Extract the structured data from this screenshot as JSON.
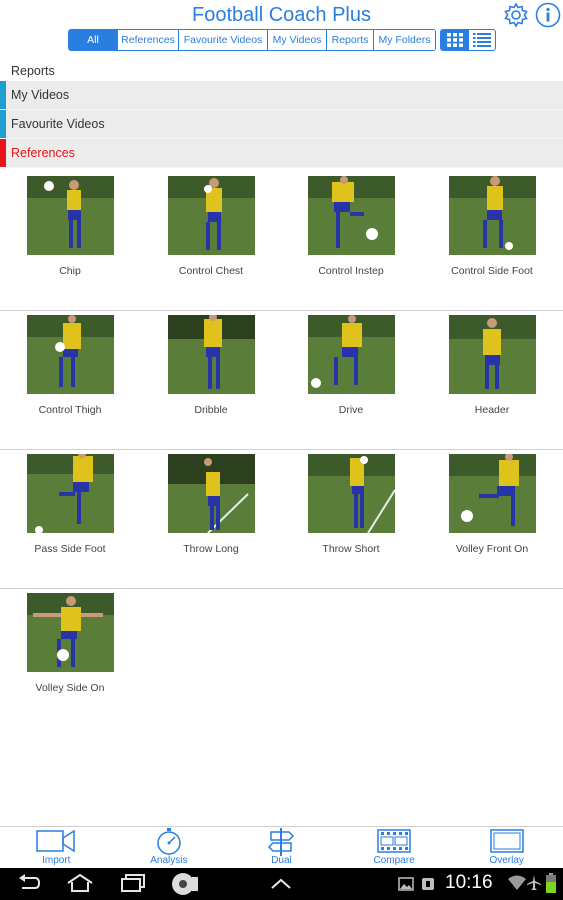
{
  "header": {
    "title": "Football Coach Plus",
    "filters": [
      "All",
      "References",
      "Favourite Videos",
      "My Videos",
      "Reports",
      "My Folders"
    ],
    "active_filter": "All"
  },
  "sections": {
    "reports": "Reports",
    "my_videos": "My Videos",
    "favourite_videos": "Favourite Videos",
    "references": "References"
  },
  "colors": {
    "accent": "#2a7ee0",
    "my_videos_bar": "#1f9ed3",
    "references_bar": "#e8141c",
    "references_text": "#e8141c"
  },
  "grid": {
    "items": [
      {
        "label": "Chip"
      },
      {
        "label": "Control Chest"
      },
      {
        "label": "Control Instep"
      },
      {
        "label": "Control Side Foot"
      },
      {
        "label": "Control Thigh"
      },
      {
        "label": "Dribble"
      },
      {
        "label": "Drive"
      },
      {
        "label": "Header"
      },
      {
        "label": "Pass Side Foot"
      },
      {
        "label": "Throw Long"
      },
      {
        "label": "Throw Short"
      },
      {
        "label": "Volley Front On"
      },
      {
        "label": "Volley Side On"
      }
    ]
  },
  "toolbar": {
    "import": "Import",
    "analysis": "Analysis",
    "dual": "Dual",
    "compare": "Compare",
    "overlay": "Overlay"
  },
  "status": {
    "time": "10:16"
  }
}
